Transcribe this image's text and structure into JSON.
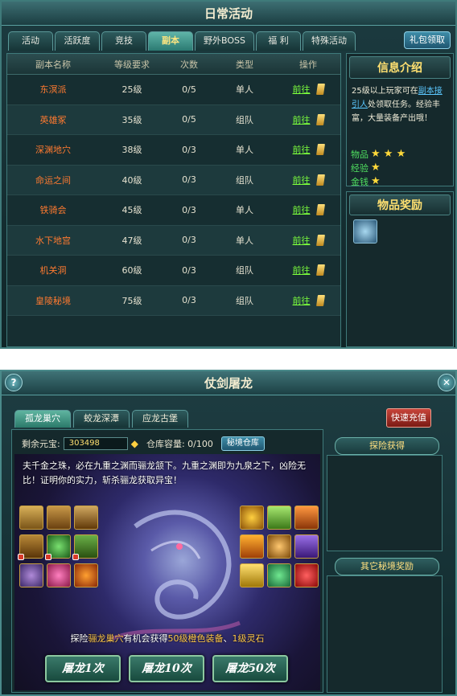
{
  "panel1": {
    "title": "日常活动",
    "tabs": [
      "活动",
      "活跃度",
      "竞技",
      "副本",
      "野外BOSS",
      "福 利",
      "特殊活动"
    ],
    "active_tab": "副本",
    "gift_button": "礼包领取",
    "table": {
      "headers": [
        "副本名称",
        "等级要求",
        "次数",
        "类型",
        "操作"
      ],
      "rows": [
        {
          "name": "东溟派",
          "level": "25级",
          "count": "0/5",
          "type": "单人",
          "action": "前往"
        },
        {
          "name": "英雄冢",
          "level": "35级",
          "count": "0/5",
          "type": "组队",
          "action": "前往"
        },
        {
          "name": "深渊地穴",
          "level": "38级",
          "count": "0/3",
          "type": "单人",
          "action": "前往"
        },
        {
          "name": "命运之间",
          "level": "40级",
          "count": "0/3",
          "type": "组队",
          "action": "前往"
        },
        {
          "name": "铁骑会",
          "level": "45级",
          "count": "0/3",
          "type": "单人",
          "action": "前往"
        },
        {
          "name": "水下地宫",
          "level": "47级",
          "count": "0/3",
          "type": "单人",
          "action": "前往"
        },
        {
          "name": "机关洞",
          "level": "60级",
          "count": "0/3",
          "type": "组队",
          "action": "前往"
        },
        {
          "name": "皇陵秘境",
          "level": "75级",
          "count": "0/3",
          "type": "组队",
          "action": "前往"
        }
      ]
    },
    "info": {
      "title": "信息介绍",
      "text_before": "25级以上玩家可在",
      "link": "副本接引人",
      "text_after": "处领取任务。经验丰富，大量装备产出哦！",
      "ratings": [
        {
          "label": "物品",
          "stars": "★ ★ ★"
        },
        {
          "label": "经验",
          "stars": "★"
        },
        {
          "label": "金钱",
          "stars": "★"
        }
      ]
    },
    "reward": {
      "title": "物品奖励"
    }
  },
  "panel2": {
    "title": "仗剑屠龙",
    "help": "?",
    "close": "✕",
    "tabs": [
      "孤龙巢穴",
      "蛟龙深潭",
      "应龙古堡"
    ],
    "active_tab": "孤龙巢穴",
    "recharge_button": "快速充值",
    "ingot_label": "剩余元宝:",
    "ingot_value": "303498",
    "storage_label": "仓库容量: 0/100",
    "storage_button": "秘境仓库",
    "description": "夫千金之珠，必在九重之渊而骊龙颔下。九重之渊即为九泉之下，凶险无比！证明你的实力，斩杀骊龙获取异宝！",
    "hint": {
      "pre": "探险",
      "place": "骊龙巢穴",
      "mid": "有机会获得",
      "item1": "50级橙色装备",
      "sep": "、",
      "item2": "1级灵石"
    },
    "buttons": [
      "屠龙1次",
      "屠龙10次",
      "屠龙50次"
    ],
    "explore_label": "探险获得",
    "other_label": "其它秘境奖励",
    "colors": {
      "accent": "#ffe070",
      "link": "#5cc8ff",
      "go": "#7cff3c",
      "dungeon_name": "#ff7a30"
    }
  }
}
